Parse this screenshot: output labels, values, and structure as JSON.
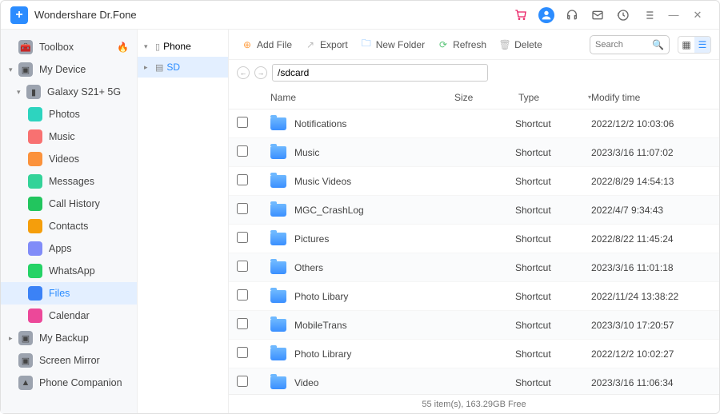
{
  "app": {
    "title": "Wondershare Dr.Fone"
  },
  "sidebar": {
    "toolbox": "Toolbox",
    "mydevice": "My Device",
    "device": "Galaxy S21+ 5G",
    "items": [
      {
        "label": "Photos",
        "icon": "ic-photos"
      },
      {
        "label": "Music",
        "icon": "ic-music"
      },
      {
        "label": "Videos",
        "icon": "ic-videos"
      },
      {
        "label": "Messages",
        "icon": "ic-messages"
      },
      {
        "label": "Call History",
        "icon": "ic-call"
      },
      {
        "label": "Contacts",
        "icon": "ic-contacts"
      },
      {
        "label": "Apps",
        "icon": "ic-apps"
      },
      {
        "label": "WhatsApp",
        "icon": "ic-whatsapp"
      },
      {
        "label": "Files",
        "icon": "ic-files",
        "active": true
      },
      {
        "label": "Calendar",
        "icon": "ic-calendar"
      }
    ],
    "mybackup": "My Backup",
    "screenmirror": "Screen Mirror",
    "phonecompanion": "Phone Companion"
  },
  "storage": {
    "phone": "Phone",
    "sd": "SD"
  },
  "toolbar": {
    "addfile": "Add File",
    "export": "Export",
    "newfolder": "New Folder",
    "refresh": "Refresh",
    "delete": "Delete",
    "search_placeholder": "Search"
  },
  "path": "/sdcard",
  "columns": {
    "name": "Name",
    "size": "Size",
    "type": "Type",
    "modify": "Modify time"
  },
  "rows": [
    {
      "name": "Notifications",
      "type": "Shortcut",
      "modify": "2022/12/2 10:03:06"
    },
    {
      "name": "Music",
      "type": "Shortcut",
      "modify": "2023/3/16 11:07:02"
    },
    {
      "name": "Music Videos",
      "type": "Shortcut",
      "modify": "2022/8/29 14:54:13"
    },
    {
      "name": "MGC_CrashLog",
      "type": "Shortcut",
      "modify": "2022/4/7 9:34:43"
    },
    {
      "name": "Pictures",
      "type": "Shortcut",
      "modify": "2022/8/22 11:45:24"
    },
    {
      "name": "Others",
      "type": "Shortcut",
      "modify": "2023/3/16 11:01:18"
    },
    {
      "name": "Photo Libary",
      "type": "Shortcut",
      "modify": "2022/11/24 13:38:22"
    },
    {
      "name": "MobileTrans",
      "type": "Shortcut",
      "modify": "2023/3/10 17:20:57"
    },
    {
      "name": "Photo Library",
      "type": "Shortcut",
      "modify": "2022/12/2 10:02:27"
    },
    {
      "name": "Video",
      "type": "Shortcut",
      "modify": "2023/3/16 11:06:34"
    }
  ],
  "status": "55 item(s), 163.29GB Free"
}
